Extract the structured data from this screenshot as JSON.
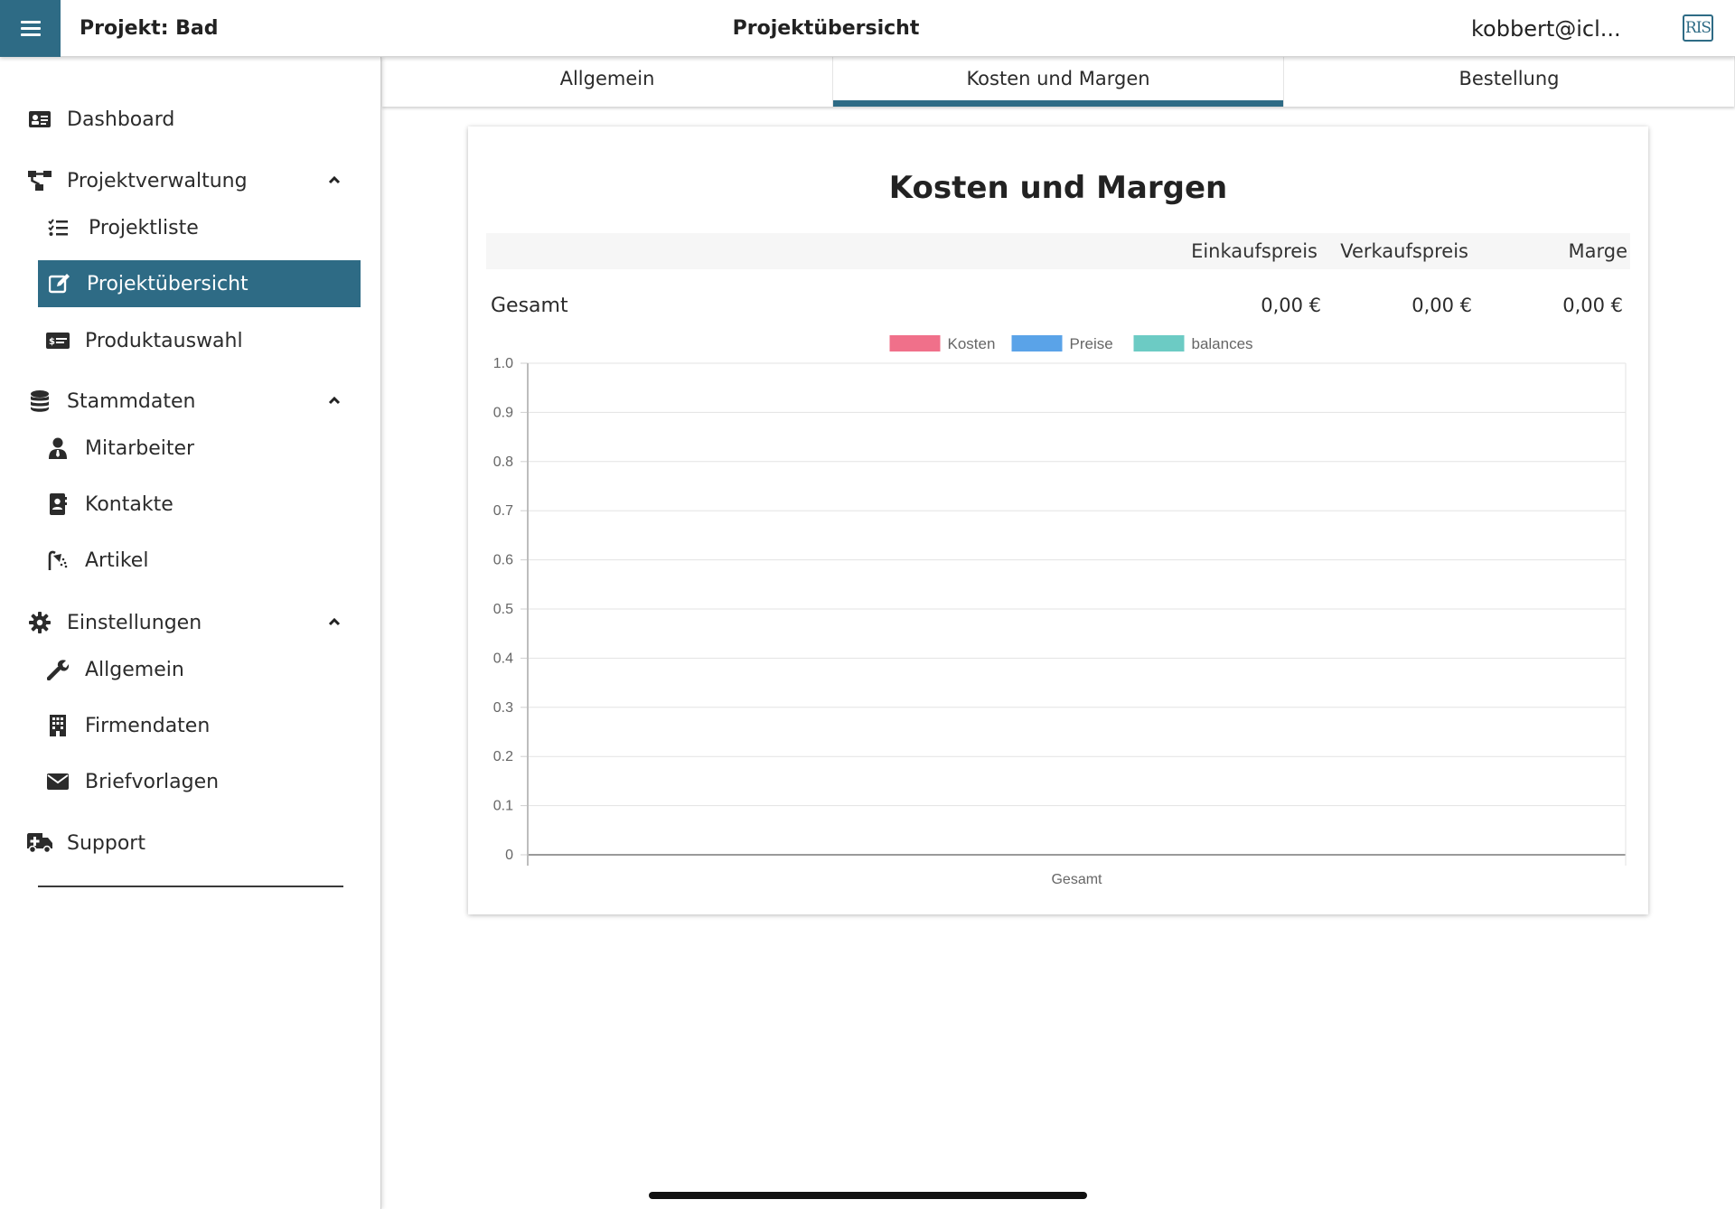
{
  "header": {
    "project_title": "Projekt: Bad",
    "page_title": "Projektübersicht",
    "user_email": "kobbert@icl...",
    "logo_text": "RIS",
    "accent_color": "#2e6b85"
  },
  "sidebar": {
    "items": [
      {
        "label": "Dashboard",
        "icon": "id-card-icon"
      },
      {
        "label": "Projektverwaltung",
        "icon": "sitemap-icon"
      },
      {
        "label": "Projektliste",
        "icon": "checklist-icon"
      },
      {
        "label": "Projektübersicht",
        "icon": "edit-icon"
      },
      {
        "label": "Produktauswahl",
        "icon": "money-check-icon"
      },
      {
        "label": "Stammdaten",
        "icon": "database-icon"
      },
      {
        "label": "Mitarbeiter",
        "icon": "user-tie-icon"
      },
      {
        "label": "Kontakte",
        "icon": "address-book-icon"
      },
      {
        "label": "Artikel",
        "icon": "shower-icon"
      },
      {
        "label": "Einstellungen",
        "icon": "gear-icon"
      },
      {
        "label": "Allgemein",
        "icon": "wrench-icon"
      },
      {
        "label": "Firmendaten",
        "icon": "building-icon"
      },
      {
        "label": "Briefvorlagen",
        "icon": "envelope-icon"
      },
      {
        "label": "Support",
        "icon": "ambulance-icon"
      }
    ]
  },
  "tabs": [
    {
      "label": "Allgemein"
    },
    {
      "label": "Kosten und Margen"
    },
    {
      "label": "Bestellung"
    }
  ],
  "card": {
    "title": "Kosten und Margen",
    "columns": [
      "Einkaufspreis",
      "Verkaufspreis",
      "Marge"
    ],
    "row": {
      "label": "Gesamt",
      "values": [
        "0,00 €",
        "0,00 €",
        "0,00 €"
      ]
    }
  },
  "chart_data": {
    "type": "bar",
    "categories": [
      "Gesamt"
    ],
    "series": [
      {
        "name": "Kosten",
        "values": [
          0
        ],
        "color": "#f0708a"
      },
      {
        "name": "Preise",
        "values": [
          0
        ],
        "color": "#5aa3e8"
      },
      {
        "name": "balances",
        "values": [
          0
        ],
        "color": "#6ccbc4"
      }
    ],
    "ylim": [
      0,
      1.0
    ],
    "yticks": [
      "0",
      "0.1",
      "0.2",
      "0.3",
      "0.4",
      "0.5",
      "0.6",
      "0.7",
      "0.8",
      "0.9",
      "1.0"
    ],
    "legend": "top",
    "grid": true
  }
}
